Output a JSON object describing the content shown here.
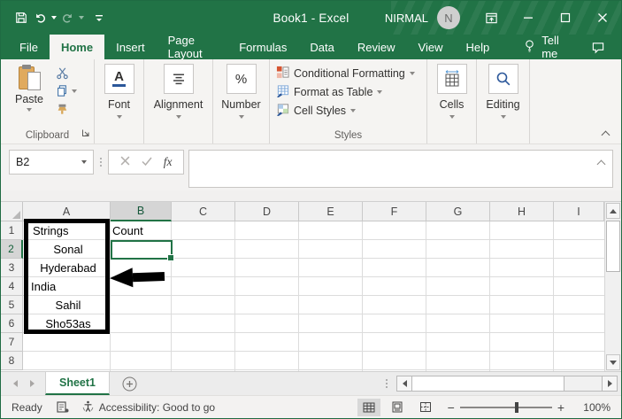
{
  "window": {
    "title": "Book1 - Excel",
    "user_name": "NIRMAL",
    "avatar_initial": "N"
  },
  "tabs": [
    {
      "label": "File"
    },
    {
      "label": "Home"
    },
    {
      "label": "Insert"
    },
    {
      "label": "Page Layout"
    },
    {
      "label": "Formulas"
    },
    {
      "label": "Data"
    },
    {
      "label": "Review"
    },
    {
      "label": "View"
    },
    {
      "label": "Help"
    },
    {
      "label": "Tell me"
    }
  ],
  "ribbon": {
    "paste_label": "Paste",
    "clipboard_group_label": "Clipboard",
    "font_icon_letter": "A",
    "font_group_label": "Font",
    "alignment_group_label": "Alignment",
    "number_icon": "%",
    "number_group_label": "Number",
    "styles_items": [
      {
        "label": "Conditional Formatting"
      },
      {
        "label": "Format as Table"
      },
      {
        "label": "Cell Styles"
      }
    ],
    "styles_group_label": "Styles",
    "cells_group_label": "Cells",
    "editing_group_label": "Editing"
  },
  "formula_bar": {
    "name_box_value": "B2",
    "fx_label": "fx"
  },
  "grid": {
    "columns": [
      "A",
      "B",
      "C",
      "D",
      "E",
      "F",
      "G",
      "H",
      "I"
    ],
    "rows": [
      "1",
      "2",
      "3",
      "4",
      "5",
      "6",
      "7",
      "8"
    ],
    "cells": {
      "a1": "Strings",
      "b1": "Count",
      "a2": "Sonal",
      "a3": "Hyderabad",
      "a4": "India",
      "a5": "Sahil",
      "a6": "Sho53as"
    },
    "selected_cell": "B2"
  },
  "sheet_tabs": {
    "active_tab": "Sheet1"
  },
  "status_bar": {
    "mode": "Ready",
    "accessibility": "Accessibility: Good to go",
    "zoom_out": "−",
    "zoom_in": "+",
    "zoom_level": "100%"
  },
  "colors": {
    "excel_green": "#217346",
    "selection_border": "#217346",
    "annotation": "#000000"
  }
}
